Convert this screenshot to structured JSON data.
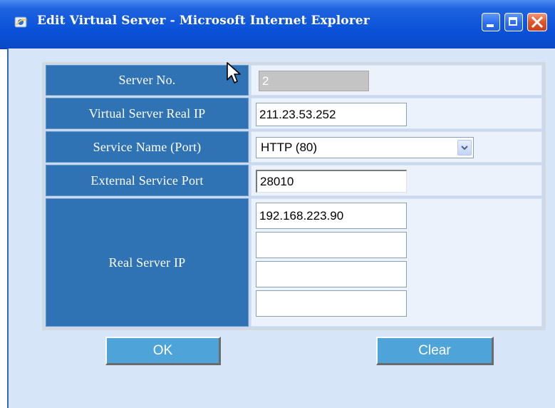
{
  "window": {
    "title": "Edit Virtual Server - Microsoft Internet Explorer",
    "icon": "ie-icon",
    "controls": [
      "minimize-icon",
      "maximize-icon",
      "close-icon"
    ]
  },
  "form": {
    "server_no": {
      "label": "Server No.",
      "value": "2",
      "disabled": true
    },
    "virtual_server_real_ip": {
      "label": "Virtual Server Real IP",
      "value": "211.23.53.252"
    },
    "service_name": {
      "label": "Service Name (Port)",
      "selected": "HTTP (80)",
      "icon": "chevron-down-icon"
    },
    "external_service_port": {
      "label": "External Service Port",
      "value": "28010"
    },
    "real_server_ip": {
      "label": "Real Server IP",
      "values": [
        "192.168.223.90",
        "",
        "",
        ""
      ]
    }
  },
  "buttons": {
    "ok": "OK",
    "clear": "Clear"
  },
  "colors": {
    "label_background": "#2f73b5",
    "value_background": "#ecf2fb",
    "button_background": "#4ea4d9",
    "client_background": "#d7e5f9"
  }
}
